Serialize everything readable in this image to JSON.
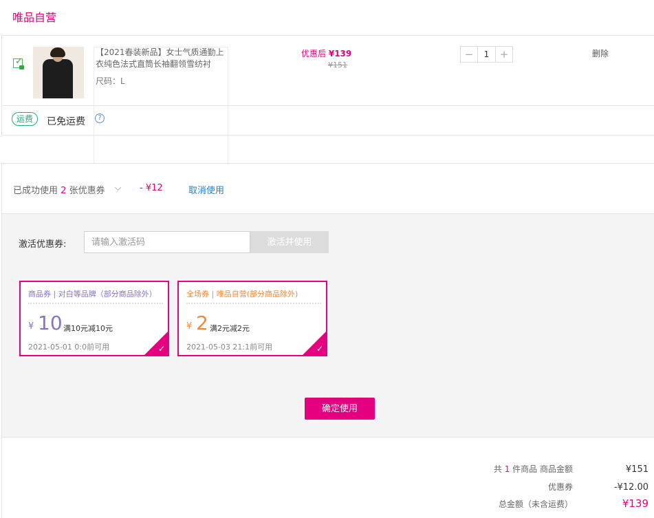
{
  "store": {
    "title": "唯品自营"
  },
  "product": {
    "name": "【2021春装新品】女士气质通勤上衣纯色法式直筒长袖翻领雪纺衬",
    "size": "尺码：L",
    "price_label": "优惠后",
    "price_after": "¥139",
    "price_original": "¥151",
    "quantity": "1",
    "minus": "−",
    "plus": "+",
    "delete_label": "删除"
  },
  "shipping": {
    "badge": "运费",
    "text": "已免运费",
    "help": "?"
  },
  "coupon_usage": {
    "prefix": "已成功使用",
    "count": "2",
    "suffix": "张优惠券",
    "discount": "- ¥12",
    "cancel_label": "取消使用"
  },
  "activate": {
    "label": "激活优惠券:",
    "placeholder": "请输入激活码",
    "button_label": "激活并使用"
  },
  "coupons": [
    {
      "title": "商品券 | 对白等品牌（部分商品除外）",
      "yen": "¥",
      "amount": "10",
      "rule": "满10元减10元",
      "valid": "2021-05-01 0:0前可用",
      "check": "✓"
    },
    {
      "title": "全场券 | 唯品自营(部分商品除外)",
      "yen": "¥",
      "amount": "2",
      "rule": "满2元减2元",
      "valid": "2021-05-03 21:1前可用",
      "check": "✓"
    }
  ],
  "confirm": {
    "label": "确定使用"
  },
  "summary": {
    "items_prefix": "共",
    "items_count": "1",
    "items_suffix": "件商品  商品金额",
    "items_amount": "¥151",
    "coupon_label": "优惠券",
    "coupon_amount": "-¥12.00",
    "total_label": "总金额（未含运费）",
    "total_amount": "¥139"
  },
  "colors": {
    "brand": "#e4007f",
    "coupon_product": "#8a73c4",
    "coupon_store": "#ee8a3c",
    "shipping": "#1cae79",
    "link": "#2a7fc4"
  }
}
